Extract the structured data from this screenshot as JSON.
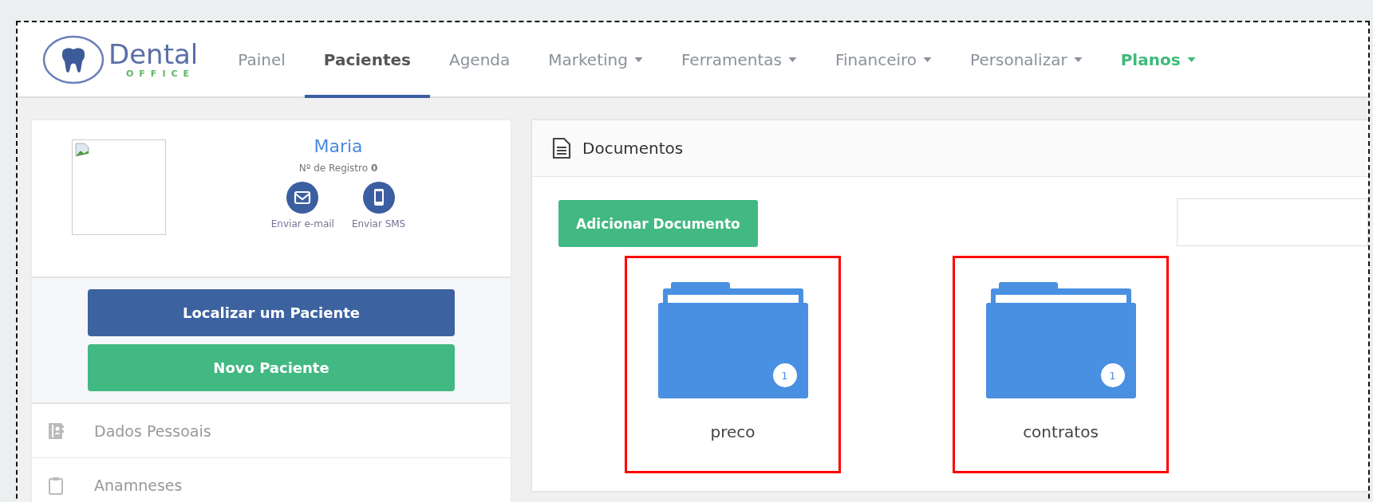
{
  "logo": {
    "name": "Dental",
    "tagline": "OFFICE"
  },
  "nav": [
    {
      "label": "Painel",
      "selected": false,
      "dropdown": false,
      "emphasized": false
    },
    {
      "label": "Pacientes",
      "selected": true,
      "dropdown": false,
      "emphasized": false
    },
    {
      "label": "Agenda",
      "selected": false,
      "dropdown": false,
      "emphasized": false
    },
    {
      "label": "Marketing",
      "selected": false,
      "dropdown": true,
      "emphasized": false
    },
    {
      "label": "Ferramentas",
      "selected": false,
      "dropdown": true,
      "emphasized": false
    },
    {
      "label": "Financeiro",
      "selected": false,
      "dropdown": true,
      "emphasized": false
    },
    {
      "label": "Personalizar",
      "selected": false,
      "dropdown": true,
      "emphasized": false
    },
    {
      "label": "Planos",
      "selected": false,
      "dropdown": true,
      "emphasized": true
    }
  ],
  "patient": {
    "name": "Maria",
    "registry": "Nº de Registro **0**",
    "actions": [
      {
        "kind": "email",
        "label": "Enviar e-mail"
      },
      {
        "kind": "sms",
        "label": "Enviar SMS"
      }
    ]
  },
  "sidebar": {
    "buttons": [
      {
        "kind": "primary",
        "label": "Localizar um Paciente"
      },
      {
        "kind": "success",
        "label": "Novo Paciente"
      }
    ],
    "items": [
      {
        "kind": "contacts",
        "label": "Dados Pessoais"
      },
      {
        "kind": "clipboard",
        "label": "Anamneses"
      }
    ]
  },
  "documents": {
    "title": "Documentos",
    "add_button": "Adicionar Documento",
    "folders": [
      {
        "name": "preco",
        "count": "1",
        "highlighted": true
      },
      {
        "name": "contratos",
        "count": "1",
        "highlighted": true
      }
    ]
  }
}
